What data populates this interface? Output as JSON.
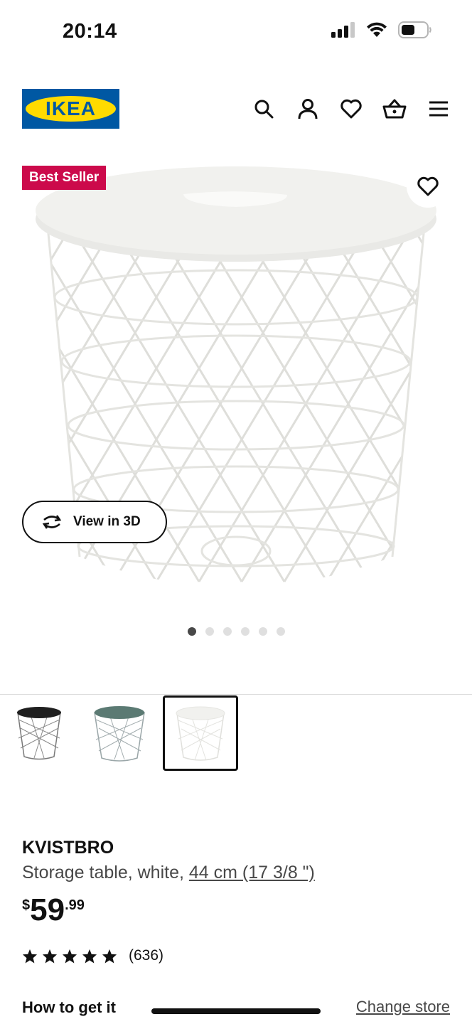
{
  "status_bar": {
    "time": "20:14"
  },
  "header": {
    "logo_text": "IKEA",
    "icons": [
      "search-icon",
      "user-icon",
      "heart-icon",
      "basket-icon",
      "menu-icon"
    ]
  },
  "product_image": {
    "badge": "Best Seller",
    "view_3d_label": "View in 3D",
    "carousel": {
      "count": 6,
      "active_index": 0
    }
  },
  "variants": [
    {
      "name": "black",
      "top_color": "#1f1f1f",
      "wire_color": "#7a7a7a",
      "selected": false
    },
    {
      "name": "green",
      "top_color": "#5b7a73",
      "wire_color": "#9aa6a8",
      "selected": false
    },
    {
      "name": "white",
      "top_color": "#f2f2ef",
      "wire_color": "#d8d8d4",
      "selected": true
    }
  ],
  "product": {
    "name": "KVISTBRO",
    "description": "Storage table, white, ",
    "size_link": "44 cm (17 3/8 \")",
    "price": {
      "currency": "$",
      "integer": "59",
      "decimal": ".99"
    },
    "rating": {
      "stars": 5,
      "count": "(636)"
    }
  },
  "availability": {
    "label": "How to get it",
    "change_store": "Change store"
  },
  "colors": {
    "brand_blue": "#0058a3",
    "brand_yellow": "#ffdb00",
    "badge": "#cc0a4b"
  }
}
